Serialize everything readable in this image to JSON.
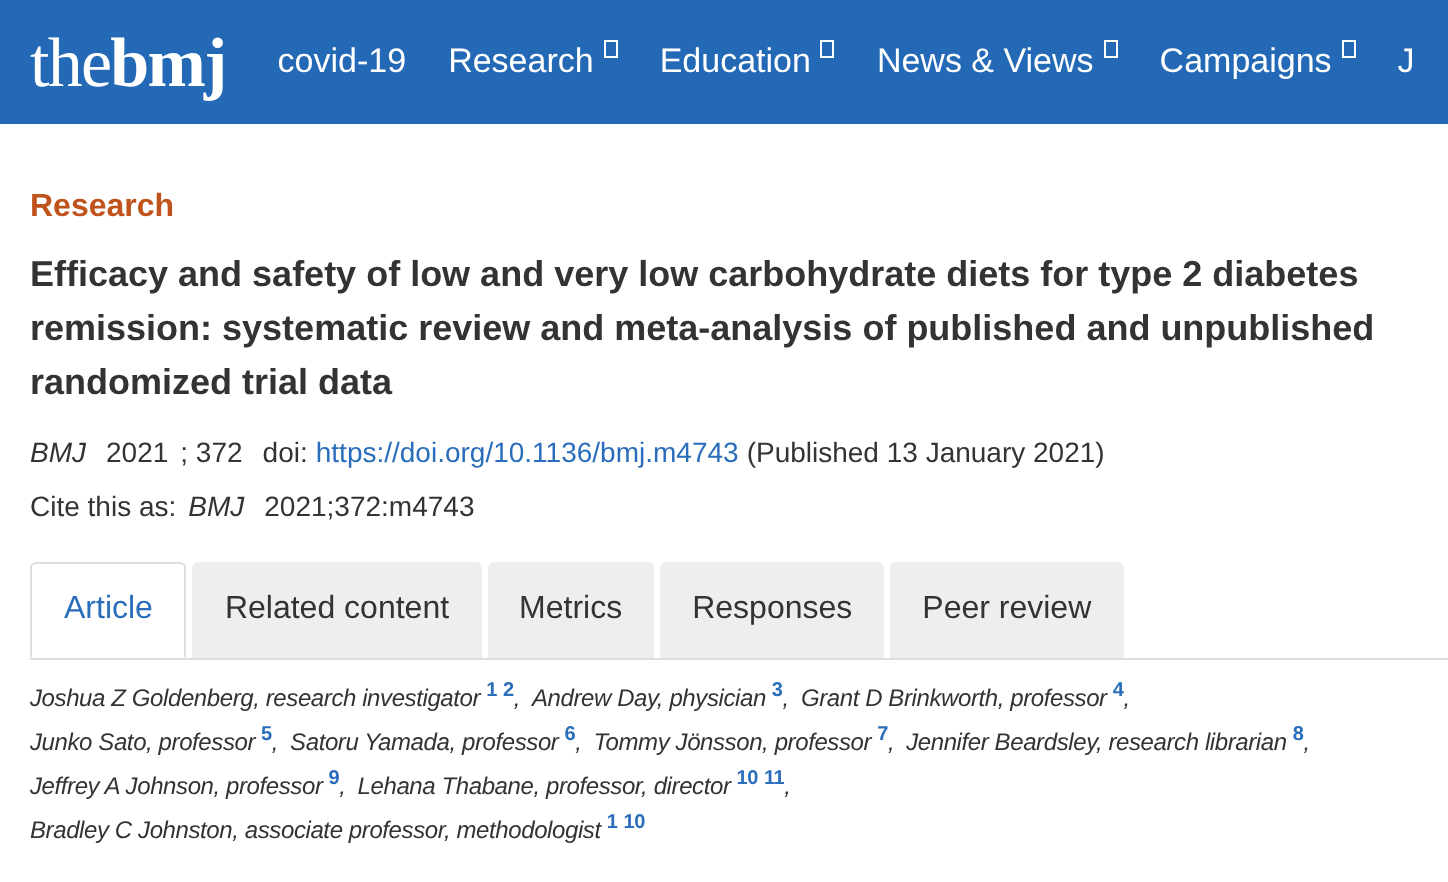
{
  "header": {
    "logo": {
      "light": "the",
      "bold": "bmj"
    },
    "nav": [
      {
        "label": "covid-19",
        "has_menu": false
      },
      {
        "label": "Research",
        "has_menu": true
      },
      {
        "label": "Education",
        "has_menu": true
      },
      {
        "label": "News & Views",
        "has_menu": true
      },
      {
        "label": "Campaigns",
        "has_menu": true
      },
      {
        "label": "J",
        "has_menu": false
      }
    ]
  },
  "article": {
    "section": "Research",
    "title": "Efficacy and safety of low and very low carbohydrate diets for type 2 diabetes remission: systematic review and meta-analysis of published and unpublished randomized trial data",
    "citation": {
      "journal": "BMJ",
      "year": "2021",
      "volume": "; 372",
      "doi_label": "doi:",
      "doi_link": "https://doi.org/10.1136/bmj.m4743",
      "published": "(Published 13 January 2021)"
    },
    "cite_as": {
      "label": "Cite this as:",
      "journal": "BMJ",
      "ref": "2021;372:m4743"
    },
    "tabs": [
      {
        "label": "Article",
        "selected": true
      },
      {
        "label": "Related content",
        "selected": false
      },
      {
        "label": "Metrics",
        "selected": false
      },
      {
        "label": "Responses",
        "selected": false
      },
      {
        "label": "Peer review",
        "selected": false
      }
    ],
    "author_lines": [
      [
        {
          "name": "Joshua Z Goldenberg, research investigator",
          "affiliations": [
            "1",
            "2"
          ],
          "separator": ","
        },
        {
          "name": "Andrew Day, physician",
          "affiliations": [
            "3"
          ],
          "separator": ","
        },
        {
          "name": "Grant D Brinkworth, professor",
          "affiliations": [
            "4"
          ],
          "separator": ","
        }
      ],
      [
        {
          "name": "Junko Sato, professor",
          "affiliations": [
            "5"
          ],
          "separator": ","
        },
        {
          "name": "Satoru Yamada, professor",
          "affiliations": [
            "6"
          ],
          "separator": ","
        },
        {
          "name": "Tommy Jönsson, professor",
          "affiliations": [
            "7"
          ],
          "separator": ","
        },
        {
          "name": "Jennifer Beardsley, research librarian",
          "affiliations": [
            "8"
          ],
          "separator": ","
        }
      ],
      [
        {
          "name": "Jeffrey A Johnson, professor",
          "affiliations": [
            "9"
          ],
          "separator": ","
        },
        {
          "name": "Lehana Thabane, professor, director",
          "affiliations": [
            "10",
            "11"
          ],
          "separator": ","
        }
      ],
      [
        {
          "name": "Bradley C Johnston, associate professor, methodologist",
          "affiliations": [
            "1",
            "10"
          ]
        }
      ]
    ]
  }
}
